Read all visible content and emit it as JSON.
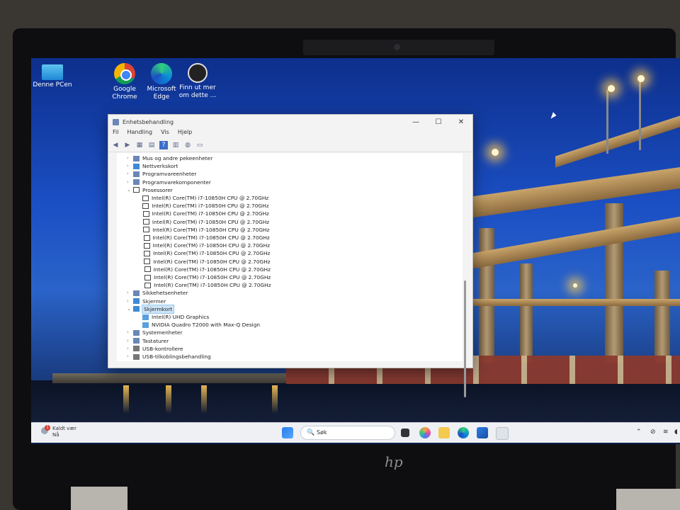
{
  "desktop": {
    "icons": [
      {
        "label": "Denne PCen"
      },
      {
        "label": "Google\nChrome"
      },
      {
        "label": "Microsoft\nEdge"
      },
      {
        "label": "Finn ut mer\nom dette ..."
      }
    ]
  },
  "window": {
    "title": "Enhetsbehandling",
    "buttons": {
      "minimize": "—",
      "maximize": "☐",
      "close": "✕"
    },
    "menu": [
      "Fil",
      "Handling",
      "Vis",
      "Hjelp"
    ],
    "tree": {
      "items": [
        {
          "label": "Mus og andre pekeenheter",
          "expander": "›"
        },
        {
          "label": "Nettverkskort",
          "expander": "›"
        },
        {
          "label": "Programvareenheter",
          "expander": "›"
        },
        {
          "label": "Programvarekomponenter",
          "expander": "›"
        },
        {
          "label": "Prosessorer",
          "expander": "⌄"
        },
        {
          "label": "Intel(R) Core(TM) i7-10850H CPU @ 2.70GHz"
        },
        {
          "label": "Intel(R) Core(TM) i7-10850H CPU @ 2.70GHz"
        },
        {
          "label": "Intel(R) Core(TM) i7-10850H CPU @ 2.70GHz"
        },
        {
          "label": "Intel(R) Core(TM) i7-10850H CPU @ 2.70GHz"
        },
        {
          "label": "Intel(R) Core(TM) i7-10850H CPU @ 2.70GHz"
        },
        {
          "label": "Intel(R) Core(TM) i7-10850H CPU @ 2.70GHz"
        },
        {
          "label": "Intel(R) Core(TM) i7-10850H CPU @ 2.70GHz"
        },
        {
          "label": "Intel(R) Core(TM) i7-10850H CPU @ 2.70GHz"
        },
        {
          "label": "Intel(R) Core(TM) i7-10850H CPU @ 2.70GHz"
        },
        {
          "label": "Intel(R) Core(TM) i7-10850H CPU @ 2.70GHz"
        },
        {
          "label": "Intel(R) Core(TM) i7-10850H CPU @ 2.70GHz"
        },
        {
          "label": "Intel(R) Core(TM) i7-10850H CPU @ 2.70GHz"
        },
        {
          "label": "Sikkehetsenheter",
          "expander": "›"
        },
        {
          "label": "Skjermer",
          "expander": "›"
        },
        {
          "label": "Skjermkort",
          "expander": "⌄"
        },
        {
          "label": "Intel(R) UHD Graphics"
        },
        {
          "label": "NVIDIA Quadro T2000 with Max-Q Design"
        },
        {
          "label": "Systemenheter",
          "expander": "›"
        },
        {
          "label": "Tastaturer",
          "expander": "›"
        },
        {
          "label": "USB-kontrollere",
          "expander": "›"
        },
        {
          "label": "USB-tilkoblingsbehandling",
          "expander": "›"
        }
      ]
    }
  },
  "taskbar": {
    "weather": {
      "line1": "Kaldt vær",
      "line2": "Nå",
      "badge": "1"
    },
    "search_placeholder": "Søk",
    "search_icon": "🔍"
  },
  "colors": {
    "selection": "#cce4f7",
    "taskbar": "#eef0f4"
  }
}
